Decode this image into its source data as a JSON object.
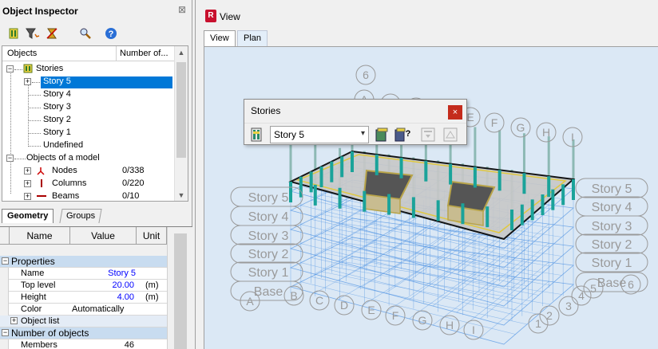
{
  "inspector": {
    "title": "Object Inspector",
    "close_glyph": "⊠",
    "tree": {
      "col_objects": "Objects",
      "col_number": "Number of...",
      "stories_label": "Stories",
      "stories": [
        "Story 5",
        "Story 4",
        "Story 3",
        "Story 2",
        "Story 1",
        "Undefined"
      ],
      "model_label": "Objects of a model",
      "model_items": [
        {
          "label": "Nodes",
          "count": "0/338"
        },
        {
          "label": "Columns",
          "count": "0/220"
        },
        {
          "label": "Beams",
          "count": "0/10"
        }
      ]
    },
    "tabs": {
      "geometry": "Geometry",
      "groups": "Groups"
    },
    "props": {
      "col_name": "Name",
      "col_value": "Value",
      "col_unit": "Unit",
      "group_properties": "Properties",
      "rows": [
        {
          "name": "Name",
          "value": "Story 5",
          "unit": ""
        },
        {
          "name": "Top level",
          "value": "20.00",
          "unit": "(m)"
        },
        {
          "name": "Height",
          "value": "4.00",
          "unit": "(m)"
        },
        {
          "name": "Color",
          "value": "Automatically",
          "unit": ""
        }
      ],
      "object_list": "Object list",
      "group_number": "Number of objects",
      "members_label": "Members",
      "members_value": "46"
    }
  },
  "view": {
    "title": "View",
    "app_letter": "R",
    "tabs": [
      "View",
      "Plan"
    ],
    "grid_top": [
      "6",
      "A",
      "B",
      "C",
      "D",
      "E",
      "F",
      "G",
      "H",
      "I"
    ],
    "grid_bottom": [
      "A",
      "B",
      "C",
      "D",
      "E",
      "F",
      "G",
      "H",
      "I"
    ],
    "grid_right_numbers": [
      "1",
      "2",
      "3",
      "4",
      "5",
      "6"
    ],
    "base_label": "Base",
    "story_labels_left": [
      "Story 5",
      "Story 4",
      "Story 3",
      "Story 2",
      "Story 1",
      "Base"
    ],
    "story_labels_right": [
      "Story 5",
      "Story 4",
      "Story 3",
      "Story 2",
      "Story 1",
      "Base"
    ],
    "colors": {
      "canvas_bg": "#dbe8f5",
      "grid": "#4a90e2",
      "column": "#1aa39a",
      "slab_edge": "#000000",
      "slab_fill": "#c8c8c8",
      "label": "#9a9a9a",
      "wall": "#b8a44a"
    }
  },
  "dialog": {
    "title": "Stories",
    "close_glyph": "×",
    "selected": "Story 5"
  }
}
